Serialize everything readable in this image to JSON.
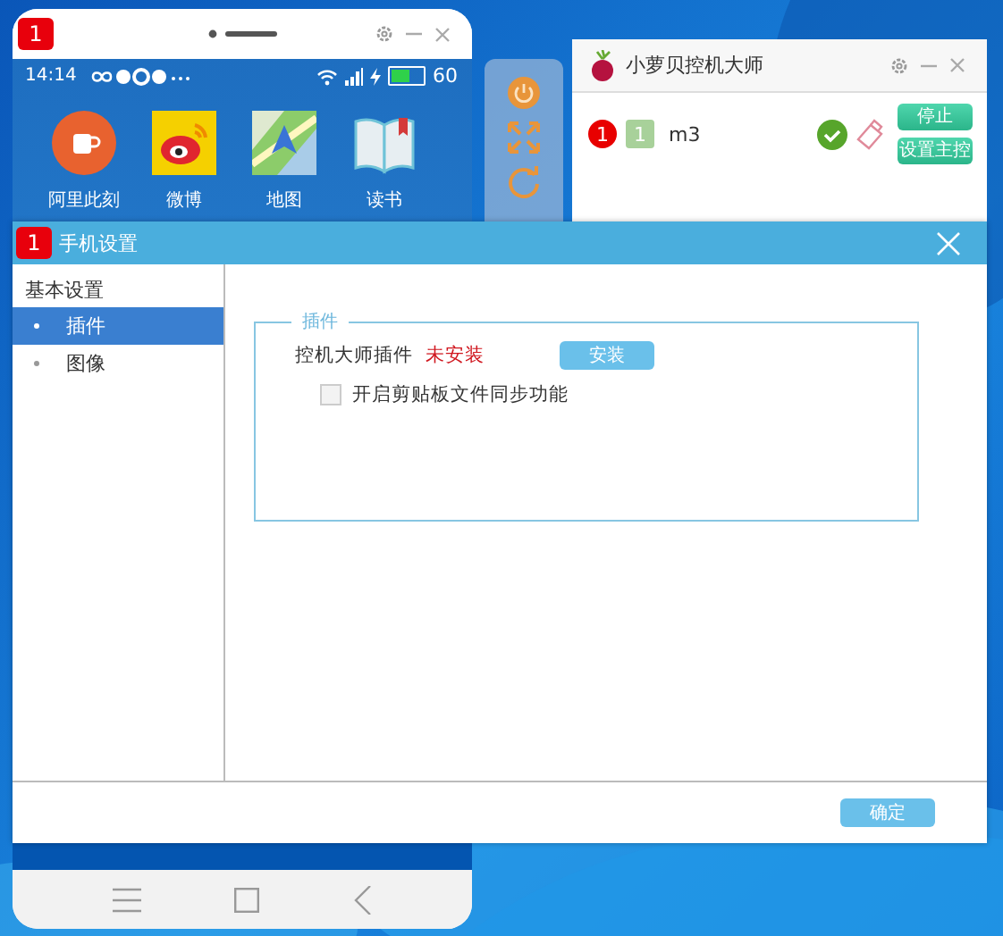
{
  "phone_window": {
    "badge": "1",
    "status_bar": {
      "time": "14:14",
      "battery": {
        "reading": "60",
        "level": 0.6
      }
    },
    "apps": [
      {
        "label": "阿里此刻"
      },
      {
        "label": "微博"
      },
      {
        "label": "地图"
      },
      {
        "label": "读书"
      }
    ]
  },
  "controller": {
    "title": "小萝贝控机大师",
    "devices": [
      {
        "index": "1",
        "group": "1",
        "name": "m3",
        "connected": true
      }
    ],
    "buttons": [
      "停止",
      "设置主控"
    ]
  },
  "dialog": {
    "badge": "1",
    "title": "手机设置",
    "sidebar": {
      "heading": "基本设置",
      "items": [
        {
          "label": "插件",
          "selected": true
        },
        {
          "label": "图像",
          "selected": false
        }
      ]
    },
    "group": {
      "legend": "插件",
      "plugin_label": "控机大师插件",
      "plugin_status": "未安装",
      "install_button": "安装",
      "checkbox": {
        "label": "开启剪贴板文件同步功能",
        "checked": false
      }
    },
    "ok_button": "确定"
  }
}
